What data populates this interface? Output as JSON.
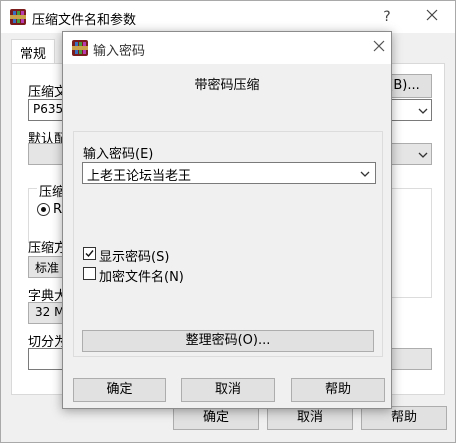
{
  "back_window": {
    "title": "压缩文件名和参数",
    "help_glyph": "?",
    "tab_general": "常规",
    "archive_name_label": "压缩文",
    "archive_name_value": "P6356(",
    "browse_button": "(B)...",
    "default_profile_label": "默认配",
    "format_group_label": "压缩文",
    "format_rar_label": "RA",
    "method_label": "压缩方",
    "method_value": "标准",
    "dict_label": "字典大",
    "dict_value": "32 MB",
    "split_label": "切分为",
    "ok_button": "确定",
    "cancel_button": "取消",
    "help_button": "帮助"
  },
  "dialog": {
    "title": "输入密码",
    "heading": "带密码压缩",
    "password_label": "输入密码(E)",
    "password_value": "上老王论坛当老王",
    "show_password_label": "显示密码(S)",
    "show_password_checked": true,
    "encrypt_names_label": "加密文件名(N)",
    "encrypt_names_checked": false,
    "organize_button": "整理密码(O)...",
    "ok_button": "确定",
    "cancel_button": "取消",
    "help_button": "帮助"
  },
  "icons": [
    "winrar-icon",
    "help-icon",
    "close-icon",
    "chevron-down-icon",
    "checkmark-icon"
  ],
  "colors": {
    "icon_maroon": "#7a1c1c",
    "icon_gold": "#c9a24a"
  }
}
